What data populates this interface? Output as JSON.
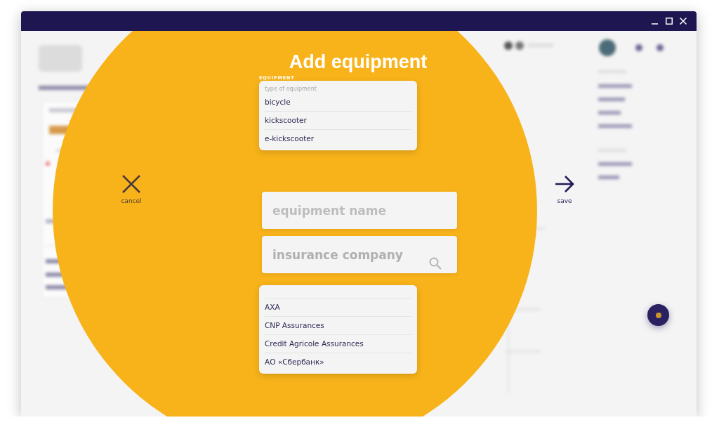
{
  "dialog": {
    "title": "Add equipment",
    "cancel": "cancel",
    "save": "save",
    "equipment_type": {
      "label": "EQUIPMENT",
      "placeholder": "type of equipment",
      "options": [
        "bicycle",
        "kickscooter",
        "e-kickscooter"
      ]
    },
    "equipment_name": {
      "placeholder": "equipment name"
    },
    "insurance": {
      "hint_text": "insurance company",
      "options": [
        "AXA",
        "CNP Assurances",
        "Credit Agricole Assurances",
        "АО «Сбербанк»"
      ]
    }
  }
}
